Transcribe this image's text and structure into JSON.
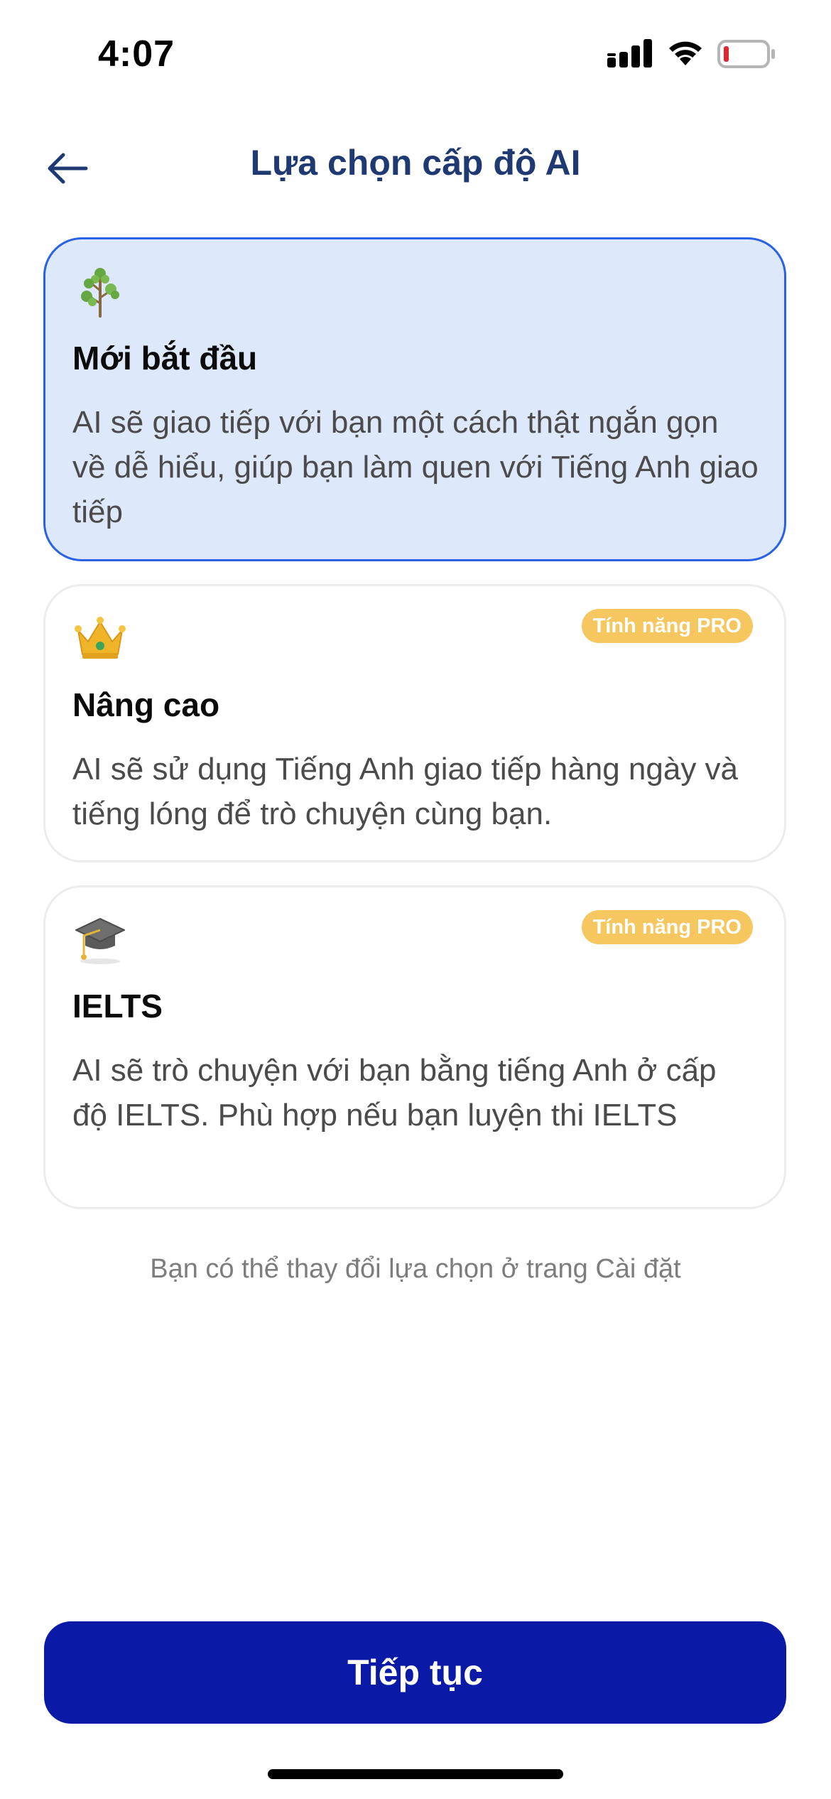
{
  "status_bar": {
    "time": "4:07"
  },
  "header": {
    "title": "Lựa chọn cấp độ AI"
  },
  "levels": [
    {
      "title": "Mới bắt đầu",
      "description": "AI sẽ giao tiếp với bạn một cách thật ngắn gọn về dễ hiểu, giúp bạn làm quen với Tiếng Anh giao tiếp",
      "icon": "sprout-icon",
      "selected": true
    },
    {
      "title": "Nâng cao",
      "description": "AI sẽ sử dụng Tiếng Anh giao tiếp hàng ngày và tiếng lóng để trò chuyện cùng bạn.",
      "icon": "crown-icon",
      "badge": "Tính năng PRO"
    },
    {
      "title": "IELTS",
      "description": "AI sẽ trò chuyện với bạn bằng tiếng Anh ở cấp độ IELTS. Phù hợp nếu bạn luyện thi IELTS",
      "icon": "graduation-cap-icon",
      "badge": "Tính năng PRO"
    }
  ],
  "hint": "Bạn có thể thay đổi lựa chọn ở trang Cài đặt",
  "continue_label": "Tiếp tục",
  "colors": {
    "title": "#1f3a73",
    "selected_border": "#2a62e6",
    "selected_bg": "#dde8fb",
    "pro_badge": "#f6c65f",
    "primary_button": "#0a19a6",
    "battery_low": "#e0262f"
  }
}
